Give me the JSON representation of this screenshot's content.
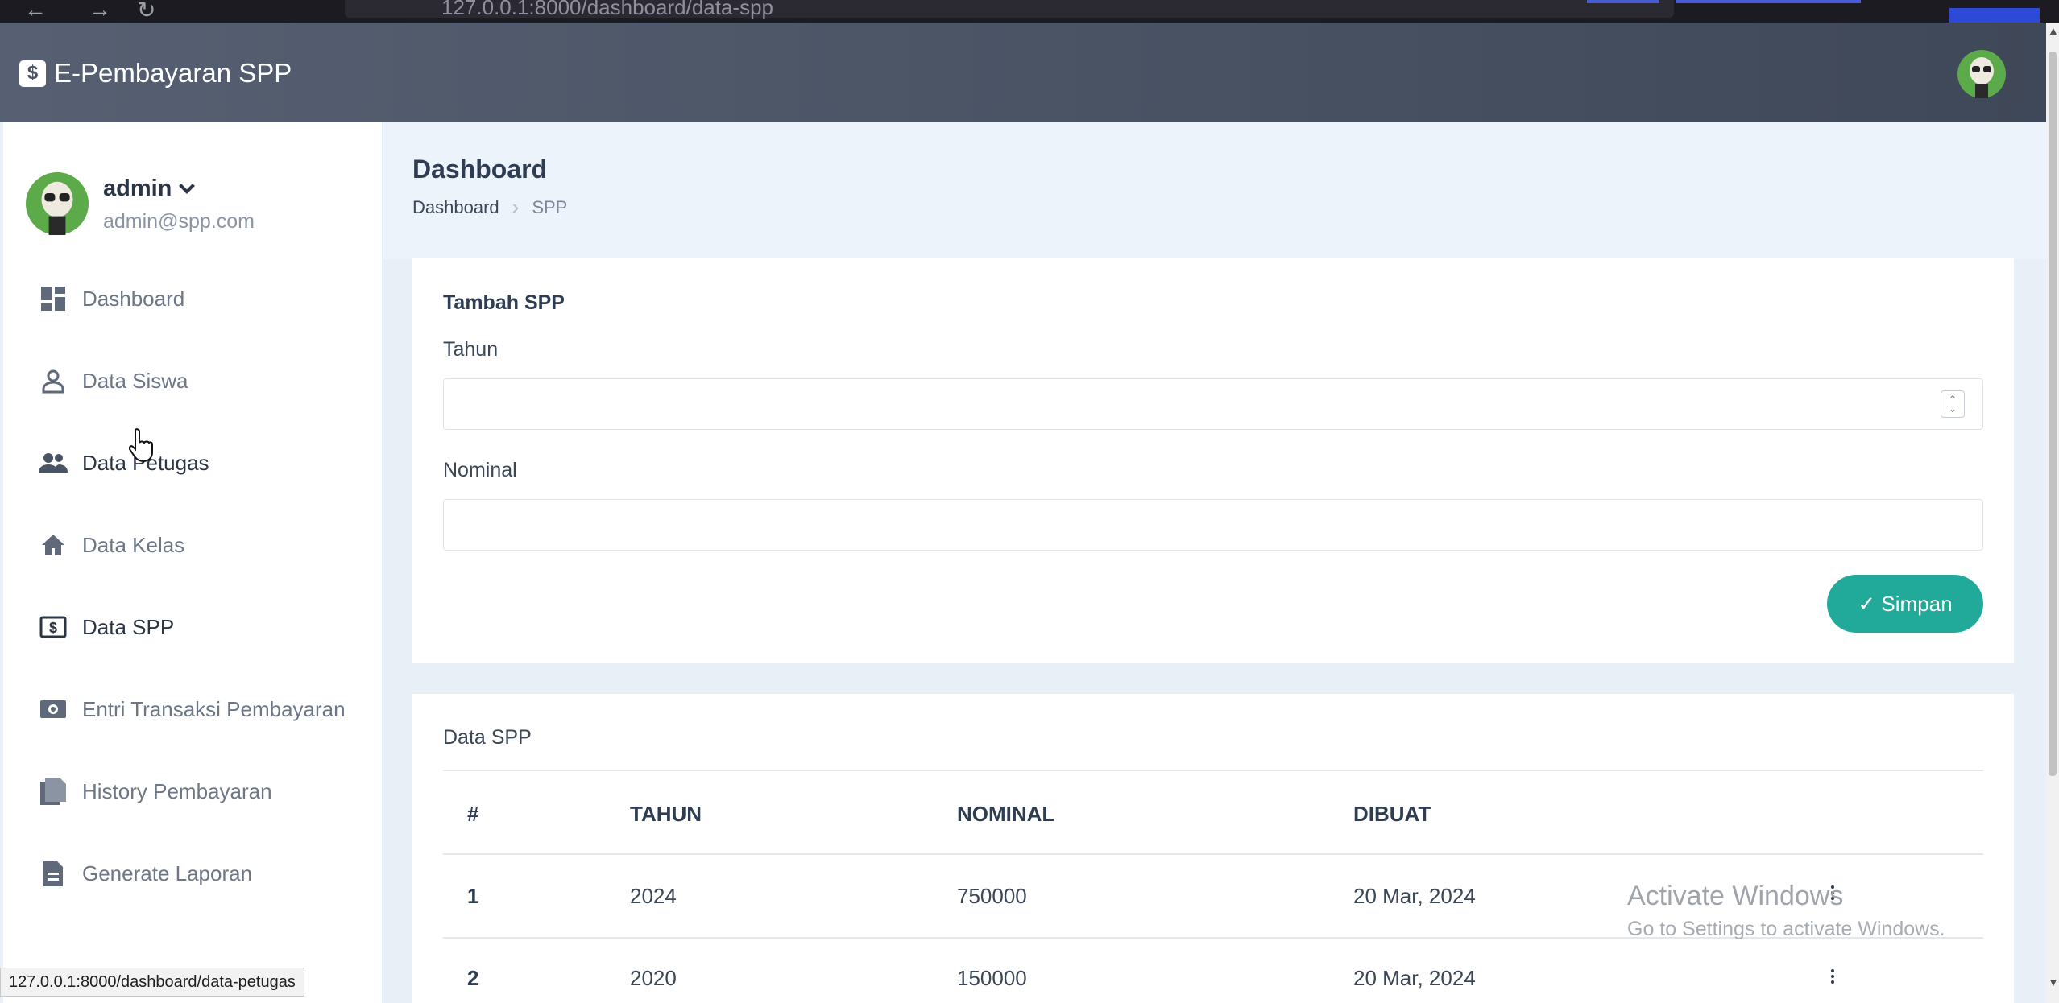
{
  "browser": {
    "url": "127.0.0.1:8000/dashboard/data-spp"
  },
  "app": {
    "brand": "E-Pembayaran SPP",
    "brand_icon": "$"
  },
  "user": {
    "name": "admin",
    "email": "admin@spp.com"
  },
  "sidebar": {
    "items": [
      {
        "label": "Dashboard",
        "icon": "dashboard-icon"
      },
      {
        "label": "Data Siswa",
        "icon": "person-icon"
      },
      {
        "label": "Data Petugas",
        "icon": "people-icon"
      },
      {
        "label": "Data Kelas",
        "icon": "home-icon"
      },
      {
        "label": "Data SPP",
        "icon": "dollar-icon"
      },
      {
        "label": "Entri Transaksi Pembayaran",
        "icon": "money-icon"
      },
      {
        "label": "History Pembayaran",
        "icon": "documents-icon"
      },
      {
        "label": "Generate Laporan",
        "icon": "file-icon"
      }
    ],
    "active": "Data SPP"
  },
  "status_url": "127.0.0.1:8000/dashboard/data-petugas",
  "page": {
    "title": "Dashboard",
    "breadcrumb": [
      "Dashboard",
      "SPP"
    ]
  },
  "form": {
    "title": "Tambah SPP",
    "tahun_label": "Tahun",
    "tahun_value": "",
    "nominal_label": "Nominal",
    "nominal_value": "",
    "save_label": "✓ Simpan"
  },
  "table": {
    "title": "Data SPP",
    "columns": [
      "#",
      "TAHUN",
      "NOMINAL",
      "DIBUAT"
    ],
    "rows": [
      {
        "no": "1",
        "tahun": "2024",
        "nominal": "750000",
        "dibuat": "20 Mar, 2024"
      },
      {
        "no": "2",
        "tahun": "2020",
        "nominal": "150000",
        "dibuat": "20 Mar, 2024"
      }
    ]
  },
  "watermark": {
    "line1": "Activate Windows",
    "line2": "Go to Settings to activate Windows."
  },
  "colors": {
    "accent": "#21aa99",
    "header": "#4b5465"
  }
}
